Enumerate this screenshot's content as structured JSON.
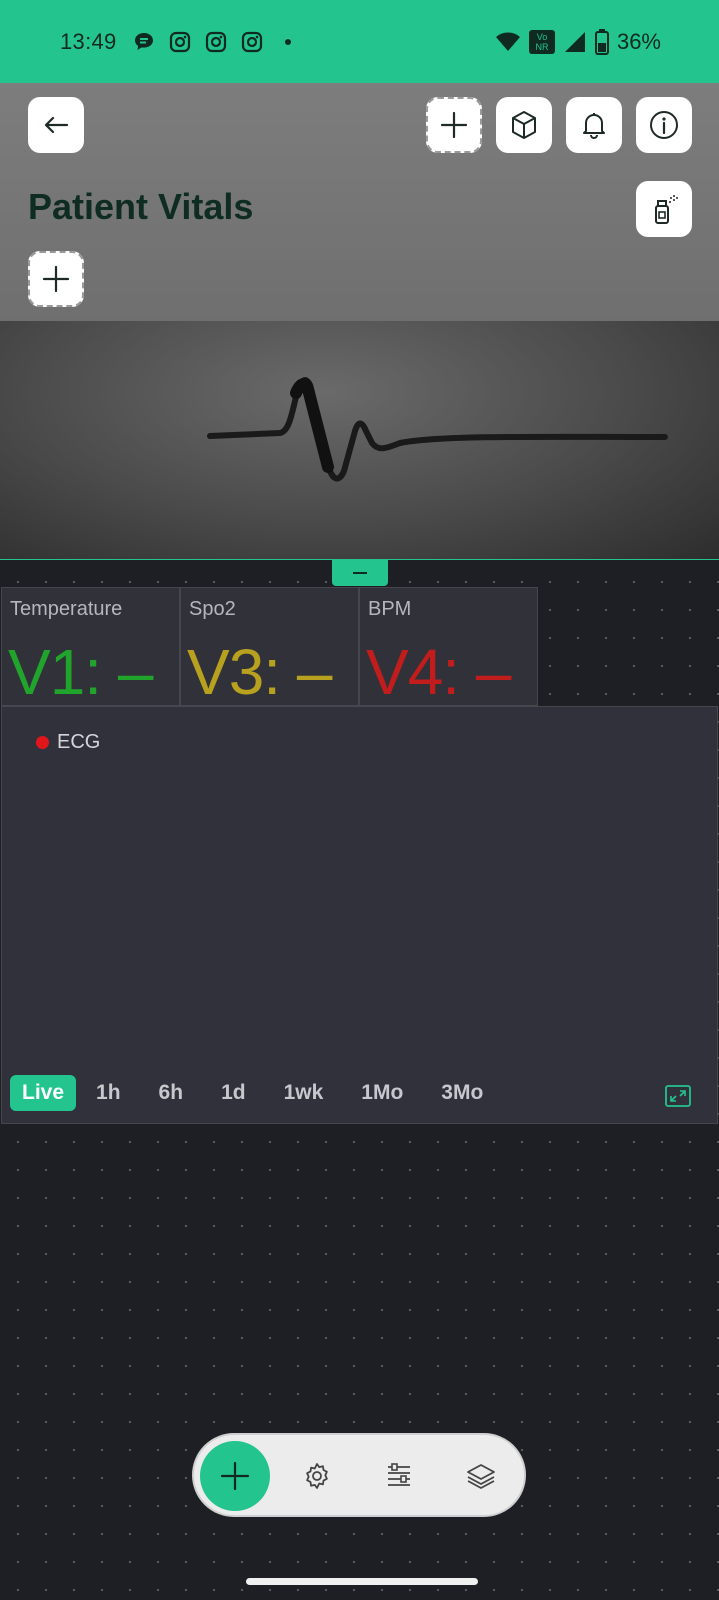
{
  "status_bar": {
    "time": "13:49",
    "battery_percent": "36%",
    "network_badge_top": "Vo",
    "network_badge_bottom": "NR",
    "left_icons": [
      "chat-bubble-icon",
      "instagram-icon",
      "instagram-icon",
      "instagram-icon",
      "dot-icon"
    ],
    "right_icons": [
      "wifi-icon",
      "vonr-icon",
      "signal-icon",
      "battery-icon"
    ]
  },
  "header": {
    "title": "Patient Vitals",
    "buttons": [
      "back-arrow-icon",
      "plus-icon",
      "cube-icon",
      "bell-icon",
      "info-icon",
      "spray-bottle-icon",
      "plus-icon"
    ]
  },
  "widgets": [
    {
      "label": "Temperature",
      "value": "V1: –",
      "color": "#21a42b"
    },
    {
      "label": "Spo2",
      "value": "V3: –",
      "color": "#b8a11e"
    },
    {
      "label": "BPM",
      "value": "V4: –",
      "color": "#c21d1d"
    }
  ],
  "chart": {
    "legend": "ECG",
    "legend_color": "#e0161a",
    "ranges": [
      "Live",
      "1h",
      "6h",
      "1d",
      "1wk",
      "1Mo",
      "3Mo"
    ],
    "active_range": "Live"
  },
  "toolbar": {
    "items": [
      "add-icon",
      "gear-icon",
      "sliders-icon",
      "layers-icon"
    ]
  },
  "colors": {
    "accent": "#23c48e",
    "background": "#1e1f24",
    "tile": "#303139"
  }
}
